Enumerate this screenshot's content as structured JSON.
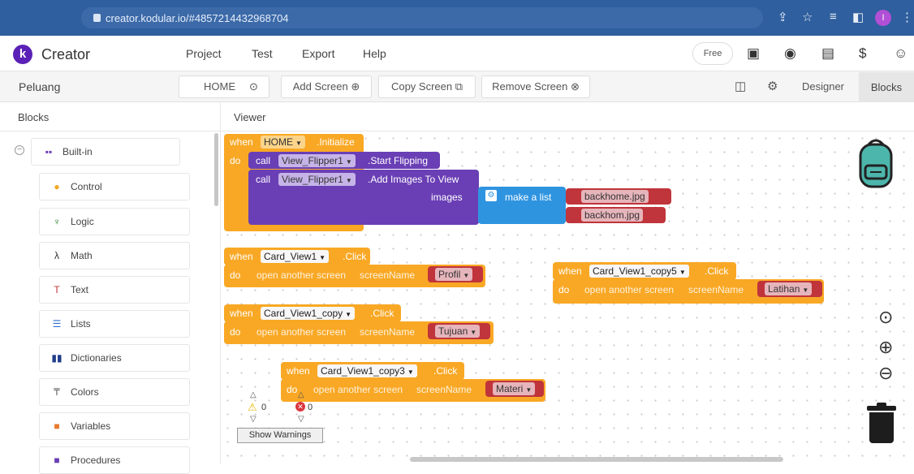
{
  "browser": {
    "url": "creator.kodular.io/#4857214432968704",
    "profile_initial": "I"
  },
  "app": {
    "logo_letter": "k",
    "name": "Creator",
    "menu": [
      "Project",
      "Test",
      "Export",
      "Help"
    ],
    "plan_label": "Free"
  },
  "toolbar": {
    "project_name": "Peluang",
    "screen_select": "HOME",
    "add_screen": "Add Screen",
    "copy_screen": "Copy Screen",
    "remove_screen": "Remove Screen",
    "designer": "Designer",
    "blocks": "Blocks"
  },
  "left_panel": {
    "heading": "Blocks",
    "root": "Built-in",
    "items": [
      "Control",
      "Logic",
      "Math",
      "Text",
      "Lists",
      "Dictionaries",
      "Colors",
      "Variables",
      "Procedures"
    ]
  },
  "viewer": {
    "heading": "Viewer"
  },
  "blocks": {
    "when": "when",
    "do": "do",
    "call": "call",
    "b1": {
      "component": "HOME",
      "event": ".Initialize",
      "call1_component": "View_Flipper1",
      "call1_method": ".Start Flipping",
      "call2_component": "View_Flipper1",
      "call2_method": ".Add Images To View",
      "param": "images",
      "list_label": "make a list",
      "str1": "backhome.jpg",
      "str2": "backhom.jpg"
    },
    "open_screen_label": "open another screen",
    "screen_name_label": "screenName",
    "event_click": ".Click",
    "b2": {
      "component": "Card_View1",
      "screen": "Profil"
    },
    "b3": {
      "component": "Card_View1_copy",
      "screen": "Tujuan"
    },
    "b4": {
      "component": "Card_View1_copy3",
      "screen": "Materi"
    },
    "b5": {
      "component": "Card_View1_copy5",
      "screen": "Latihan"
    }
  },
  "warnings": {
    "warning_count": "0",
    "error_count": "0",
    "toggle_label": "Show Warnings"
  },
  "colors": {
    "event_block": "#f9a825",
    "component_block": "#6a3fb5",
    "list_block": "#2f94e0",
    "text_block": "#c0343b",
    "chrome": "#2f5f9e"
  }
}
